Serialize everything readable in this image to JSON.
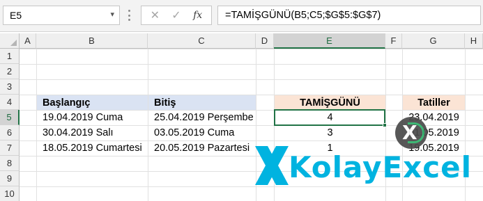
{
  "formula_bar": {
    "name_box": "E5",
    "cancel_glyph": "✕",
    "enter_glyph": "✓",
    "fx_label": "fx",
    "formula": "=TAMİŞGÜNÜ(B5;C5;$G$5:$G$7)"
  },
  "columns": [
    "A",
    "B",
    "C",
    "D",
    "E",
    "F",
    "G",
    "H"
  ],
  "rows": [
    "1",
    "2",
    "3",
    "4",
    "5",
    "6",
    "7",
    "8",
    "9",
    "10"
  ],
  "selected_cell": "E5",
  "table": {
    "header_start": "Başlangıç",
    "header_end": "Bitiş",
    "header_result": "TAMİŞGÜNÜ",
    "header_holidays": "Tatiller",
    "starts": [
      "19.04.2019 Cuma",
      "30.04.2019 Salı",
      "18.05.2019 Cumartesi"
    ],
    "ends": [
      "25.04.2019 Perşembe",
      "03.05.2019 Cuma",
      "20.05.2019 Pazartesi"
    ],
    "results": [
      "4",
      "3",
      "1"
    ],
    "holidays": [
      "23.04.2019",
      "01.05.2019",
      "19.05.2019"
    ]
  },
  "watermark": {
    "brand": "KolayExcel",
    "icon": "kolayexcel-logo-icon"
  },
  "colors": {
    "accent_green": "#217346",
    "header_blue": "#dae3f3",
    "header_peach": "#fbe4d5",
    "watermark_cyan": "#00b3e0"
  }
}
